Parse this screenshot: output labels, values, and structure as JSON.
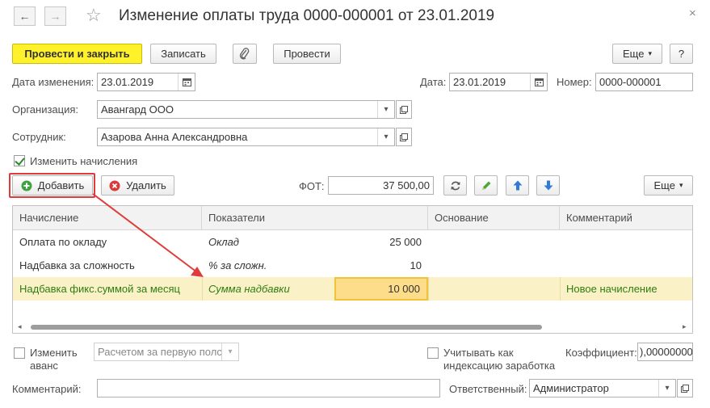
{
  "window": {
    "title": "Изменение оплаты труда 0000-000001 от 23.01.2019",
    "close_glyph": "×"
  },
  "nav": {
    "back_glyph": "←",
    "forward_glyph": "→",
    "favorite_glyph": "☆"
  },
  "toolbar": {
    "post_close_label": "Провести и закрыть",
    "save_label": "Записать",
    "post_label": "Провести",
    "more_label": "Еще",
    "help_label": "?"
  },
  "header": {
    "change_date_label": "Дата изменения:",
    "change_date_value": "23.01.2019",
    "date_label": "Дата:",
    "date_value": "23.01.2019",
    "number_label": "Номер:",
    "number_value": "0000-000001",
    "org_label": "Организация:",
    "org_value": "Авангард ООО",
    "employee_label": "Сотрудник:",
    "employee_value": "Азарова Анна Александровна",
    "change_accruals_label": "Изменить начисления",
    "change_accruals_checked": true
  },
  "table_toolbar": {
    "add_label": "Добавить",
    "delete_label": "Удалить",
    "fot_label": "ФОТ:",
    "fot_value": "37 500,00",
    "more_label": "Еще"
  },
  "table": {
    "columns": [
      "Начисление",
      "Показатели",
      "Основание",
      "Комментарий"
    ],
    "rows": [
      {
        "accrual": "Оплата по окладу",
        "indicator": "Оклад",
        "value": "25 000",
        "basis": "",
        "comment": ""
      },
      {
        "accrual": "Надбавка за сложность",
        "indicator": "% за сложн.",
        "value": "10",
        "basis": "",
        "comment": ""
      },
      {
        "accrual": "Надбавка фикс.суммой за месяц",
        "indicator": "Сумма надбавки",
        "value": "10 000",
        "basis": "",
        "comment": "Новое начисление"
      }
    ],
    "selected_row": 2
  },
  "footer": {
    "change_advance_label_1": "Изменить",
    "change_advance_label_2": "аванс",
    "advance_method_value": "Расчетом за первую полс",
    "indexation_label_1": "Учитывать как",
    "indexation_label_2": "индексацию заработка",
    "coefficient_label": "Коэффициент:",
    "coefficient_value": "),00000000",
    "comment_label": "Комментарий:",
    "comment_value": "",
    "responsible_label": "Ответственный:",
    "responsible_value": "Администратор"
  },
  "colors": {
    "primary_button": "#fff22b",
    "selected_row": "#fbf1c6",
    "active_cell": "#fddd8a",
    "highlight_box": "#e03b3b",
    "accent_green": "#2e7d12",
    "arrow_blue": "#2f7bd6"
  }
}
